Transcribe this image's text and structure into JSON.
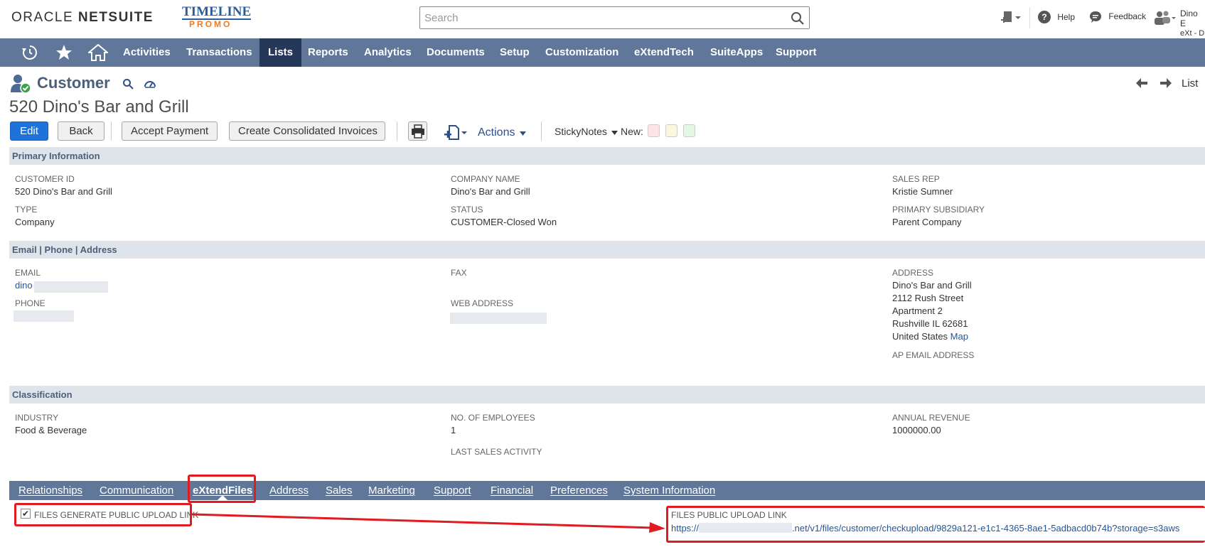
{
  "header": {
    "brand_oracle": "ORACLE",
    "brand_netsuite": "NETSUITE",
    "brand_timeline": "TIMELINE",
    "brand_promo": "PROMO",
    "search_placeholder": "Search",
    "help_label": "Help",
    "feedback_label": "Feedback",
    "user_name": "Dino E",
    "user_role": "eXt - D"
  },
  "nav": {
    "items": [
      "Activities",
      "Transactions",
      "Lists",
      "Reports",
      "Analytics",
      "Documents",
      "Setup",
      "Customization",
      "eXtendTech",
      "SuiteApps",
      "Support"
    ],
    "active": "Lists"
  },
  "record": {
    "type": "Customer",
    "title": "520 Dino's Bar and Grill",
    "list_link": "List"
  },
  "toolbar": {
    "edit": "Edit",
    "back": "Back",
    "accept_payment": "Accept Payment",
    "create_consolidated": "Create Consolidated Invoices",
    "actions": "Actions",
    "stickynotes": "StickyNotes",
    "new": "New:",
    "swatch_colors": [
      "#fbe3e6",
      "#fdf7df",
      "#e4f7e3"
    ]
  },
  "primary": {
    "heading": "Primary Information",
    "customer_id_label": "CUSTOMER ID",
    "customer_id": "520 Dino's Bar and Grill",
    "type_label": "TYPE",
    "type": "Company",
    "company_name_label": "COMPANY NAME",
    "company_name": "Dino's Bar and Grill",
    "status_label": "STATUS",
    "status": "CUSTOMER-Closed Won",
    "sales_rep_label": "SALES REP",
    "sales_rep": "Kristie Sumner",
    "subsidiary_label": "PRIMARY SUBSIDIARY",
    "subsidiary": "Parent Company"
  },
  "contact": {
    "heading": "Email | Phone | Address",
    "email_label": "EMAIL",
    "email_visible": "dino",
    "phone_label": "PHONE",
    "fax_label": "FAX",
    "web_label": "WEB ADDRESS",
    "address_label": "ADDRESS",
    "address_lines": [
      "Dino's Bar and Grill",
      "2112 Rush Street",
      "Apartment 2",
      "Rushville IL 62681"
    ],
    "address_country": "United States",
    "map_link": "Map",
    "ap_email_label": "AP EMAIL ADDRESS"
  },
  "classification": {
    "heading": "Classification",
    "industry_label": "INDUSTRY",
    "industry": "Food & Beverage",
    "employees_label": "NO. OF EMPLOYEES",
    "employees": "1",
    "last_sales_label": "LAST SALES ACTIVITY",
    "revenue_label": "ANNUAL REVENUE",
    "revenue": "1000000.00"
  },
  "subtabs": {
    "items": [
      "Relationships",
      "Communication",
      "eXtendFiles",
      "Address",
      "Sales",
      "Marketing",
      "Support",
      "Financial",
      "Preferences",
      "System Information"
    ],
    "active": "eXtendFiles"
  },
  "extendfiles": {
    "generate_label": "FILES GENERATE PUBLIC UPLOAD LINK",
    "checkbox_mark": "✔",
    "public_link_label": "FILES PUBLIC UPLOAD LINK",
    "link_prefix": "https://",
    "link_suffix": ".net/v1/files/customer/checkupload/9829a121-e1c1-4365-8ae1-5adbacd0b74b?storage=s3aws"
  },
  "colors": {
    "nav_bg": "#607799",
    "nav_active": "#25385a",
    "section_bg": "#dfe4eb",
    "primary_button": "#1f72d9",
    "highlight_red": "#e01b22"
  }
}
